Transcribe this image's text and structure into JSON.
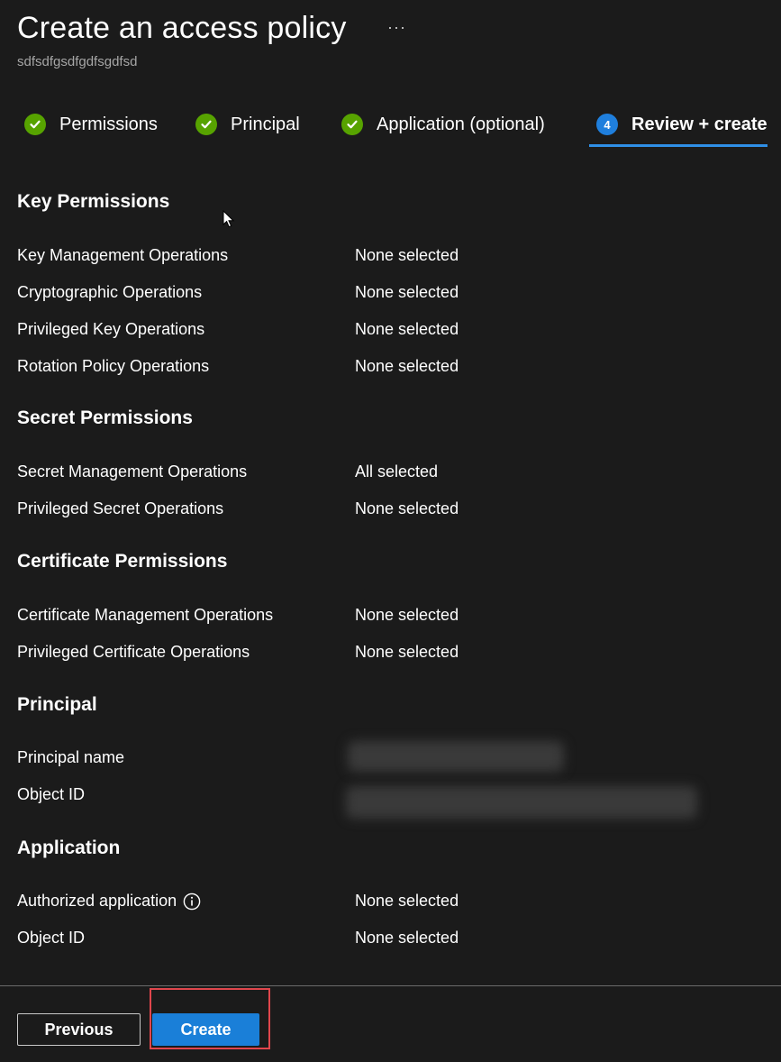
{
  "header": {
    "title": "Create an access policy",
    "more_label": "···",
    "subtitle": "sdfsdfgsdfgdfsgdfsd"
  },
  "steps": [
    {
      "label": "Permissions",
      "status": "complete",
      "icon": "checkmark-icon"
    },
    {
      "label": "Principal",
      "status": "complete",
      "icon": "checkmark-icon"
    },
    {
      "label": "Application (optional)",
      "status": "complete",
      "icon": "checkmark-icon"
    },
    {
      "label": "Review + create",
      "status": "active",
      "number": "4"
    }
  ],
  "sections": {
    "key_permissions": {
      "heading": "Key Permissions",
      "rows": [
        {
          "label": "Key Management Operations",
          "value": "None selected"
        },
        {
          "label": "Cryptographic Operations",
          "value": "None selected"
        },
        {
          "label": "Privileged Key Operations",
          "value": "None selected"
        },
        {
          "label": "Rotation Policy Operations",
          "value": "None selected"
        }
      ]
    },
    "secret_permissions": {
      "heading": "Secret Permissions",
      "rows": [
        {
          "label": "Secret Management Operations",
          "value": "All selected"
        },
        {
          "label": "Privileged Secret Operations",
          "value": "None selected"
        }
      ]
    },
    "certificate_permissions": {
      "heading": "Certificate Permissions",
      "rows": [
        {
          "label": "Certificate Management Operations",
          "value": "None selected"
        },
        {
          "label": "Privileged Certificate Operations",
          "value": "None selected"
        }
      ]
    },
    "principal": {
      "heading": "Principal",
      "rows": [
        {
          "label": "Principal name",
          "value": ""
        },
        {
          "label": "Object ID",
          "value": ""
        }
      ]
    },
    "application": {
      "heading": "Application",
      "rows": [
        {
          "label": "Authorized application",
          "value": "None selected",
          "icon": "info-icon"
        },
        {
          "label": "Object ID",
          "value": "None selected"
        }
      ]
    }
  },
  "footer": {
    "previous_label": "Previous",
    "create_label": "Create"
  },
  "colors": {
    "background": "#1b1b1b",
    "accent": "#1a7fd8",
    "success": "#57a300",
    "highlight": "#e0464c"
  }
}
